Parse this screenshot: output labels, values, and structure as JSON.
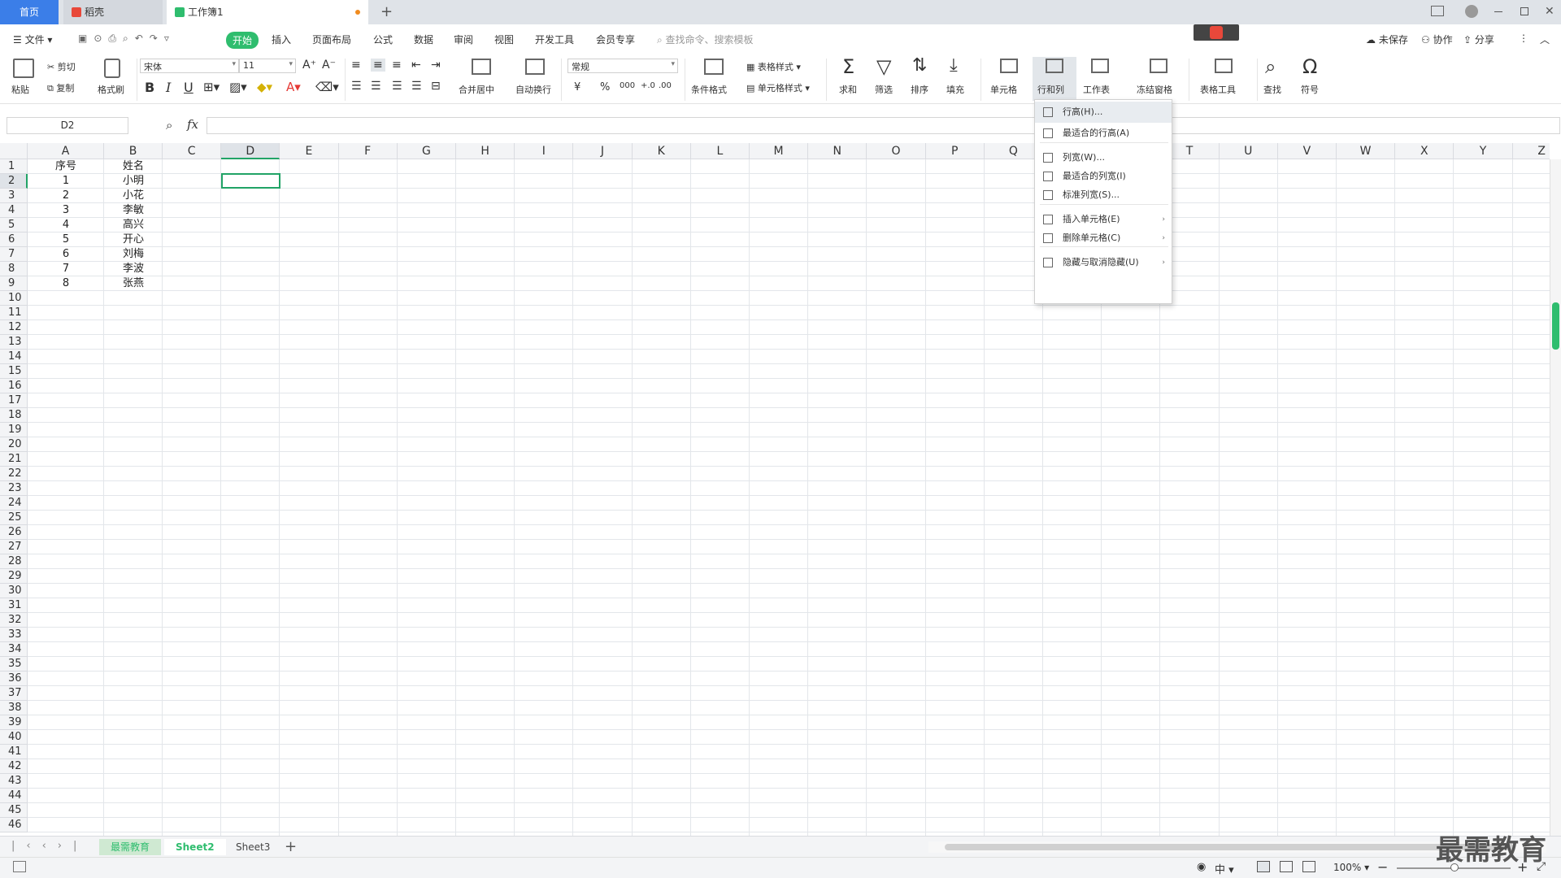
{
  "tabs": {
    "home": "首页",
    "doc": "稻壳",
    "book": "工作簿1",
    "add": "+"
  },
  "menu": {
    "file": "文件",
    "items": [
      "开始",
      "插入",
      "页面布局",
      "公式",
      "数据",
      "审阅",
      "视图",
      "开发工具",
      "会员专享"
    ],
    "search_placeholder": "查找命令、搜索模板",
    "unsaved": "未保存",
    "collab": "协作",
    "share": "分享"
  },
  "ribbon": {
    "paste": "粘贴",
    "cut": "剪切",
    "copy": "复制",
    "format_painter": "格式刷",
    "font": "宋体",
    "size": "11",
    "merge": "合并居中",
    "wrap": "自动换行",
    "number_format": "常规",
    "cond_format": "条件格式",
    "table_style": "表格样式",
    "cell_style": "单元格样式",
    "sum": "求和",
    "filter": "筛选",
    "sort": "排序",
    "fill": "填充",
    "cell": "单元格",
    "rowcol": "行和列",
    "sheet": "工作表",
    "freeze": "冻结窗格",
    "table_tools": "表格工具",
    "find": "查找",
    "symbol": "符号",
    "yen": "¥",
    "percent": "%",
    "thousands": "000",
    "inc_dec": "+.0",
    "dec_dec": ".00"
  },
  "formula": {
    "namebox": "D2",
    "fx": "fx"
  },
  "columns": [
    "A",
    "B",
    "C",
    "D",
    "E",
    "F",
    "G",
    "H",
    "I",
    "J",
    "K",
    "L",
    "M",
    "N",
    "O",
    "P",
    "Q",
    "R",
    "S",
    "T",
    "U",
    "V",
    "W",
    "X",
    "Y",
    "Z"
  ],
  "rows": 46,
  "cells": {
    "header": [
      "序号",
      "姓名"
    ],
    "data": [
      [
        "1",
        "小明"
      ],
      [
        "2",
        "小花"
      ],
      [
        "3",
        "李敏"
      ],
      [
        "4",
        "高兴"
      ],
      [
        "5",
        "开心"
      ],
      [
        "6",
        "刘梅"
      ],
      [
        "7",
        "李波"
      ],
      [
        "8",
        "张燕"
      ]
    ]
  },
  "dropdown": [
    {
      "label": "行高(H)...",
      "arrow": ""
    },
    {
      "label": "最适合的行高(A)",
      "arrow": ""
    },
    {
      "label": "列宽(W)...",
      "arrow": ""
    },
    {
      "label": "最适合的列宽(I)",
      "arrow": ""
    },
    {
      "label": "标准列宽(S)...",
      "arrow": ""
    },
    {
      "label": "插入单元格(E)",
      "arrow": "›"
    },
    {
      "label": "删除单元格(C)",
      "arrow": "›"
    },
    {
      "label": "隐藏与取消隐藏(U)",
      "arrow": "›"
    }
  ],
  "sheets": [
    "最需教育",
    "Sheet2",
    "Sheet3"
  ],
  "status": {
    "zoom": "100%",
    "lang": "中"
  },
  "watermark": "最需教育",
  "colors": {
    "accent": "#2fbd6e",
    "tab_blue": "#3b7ee8",
    "selected_cell": "#21a366"
  }
}
